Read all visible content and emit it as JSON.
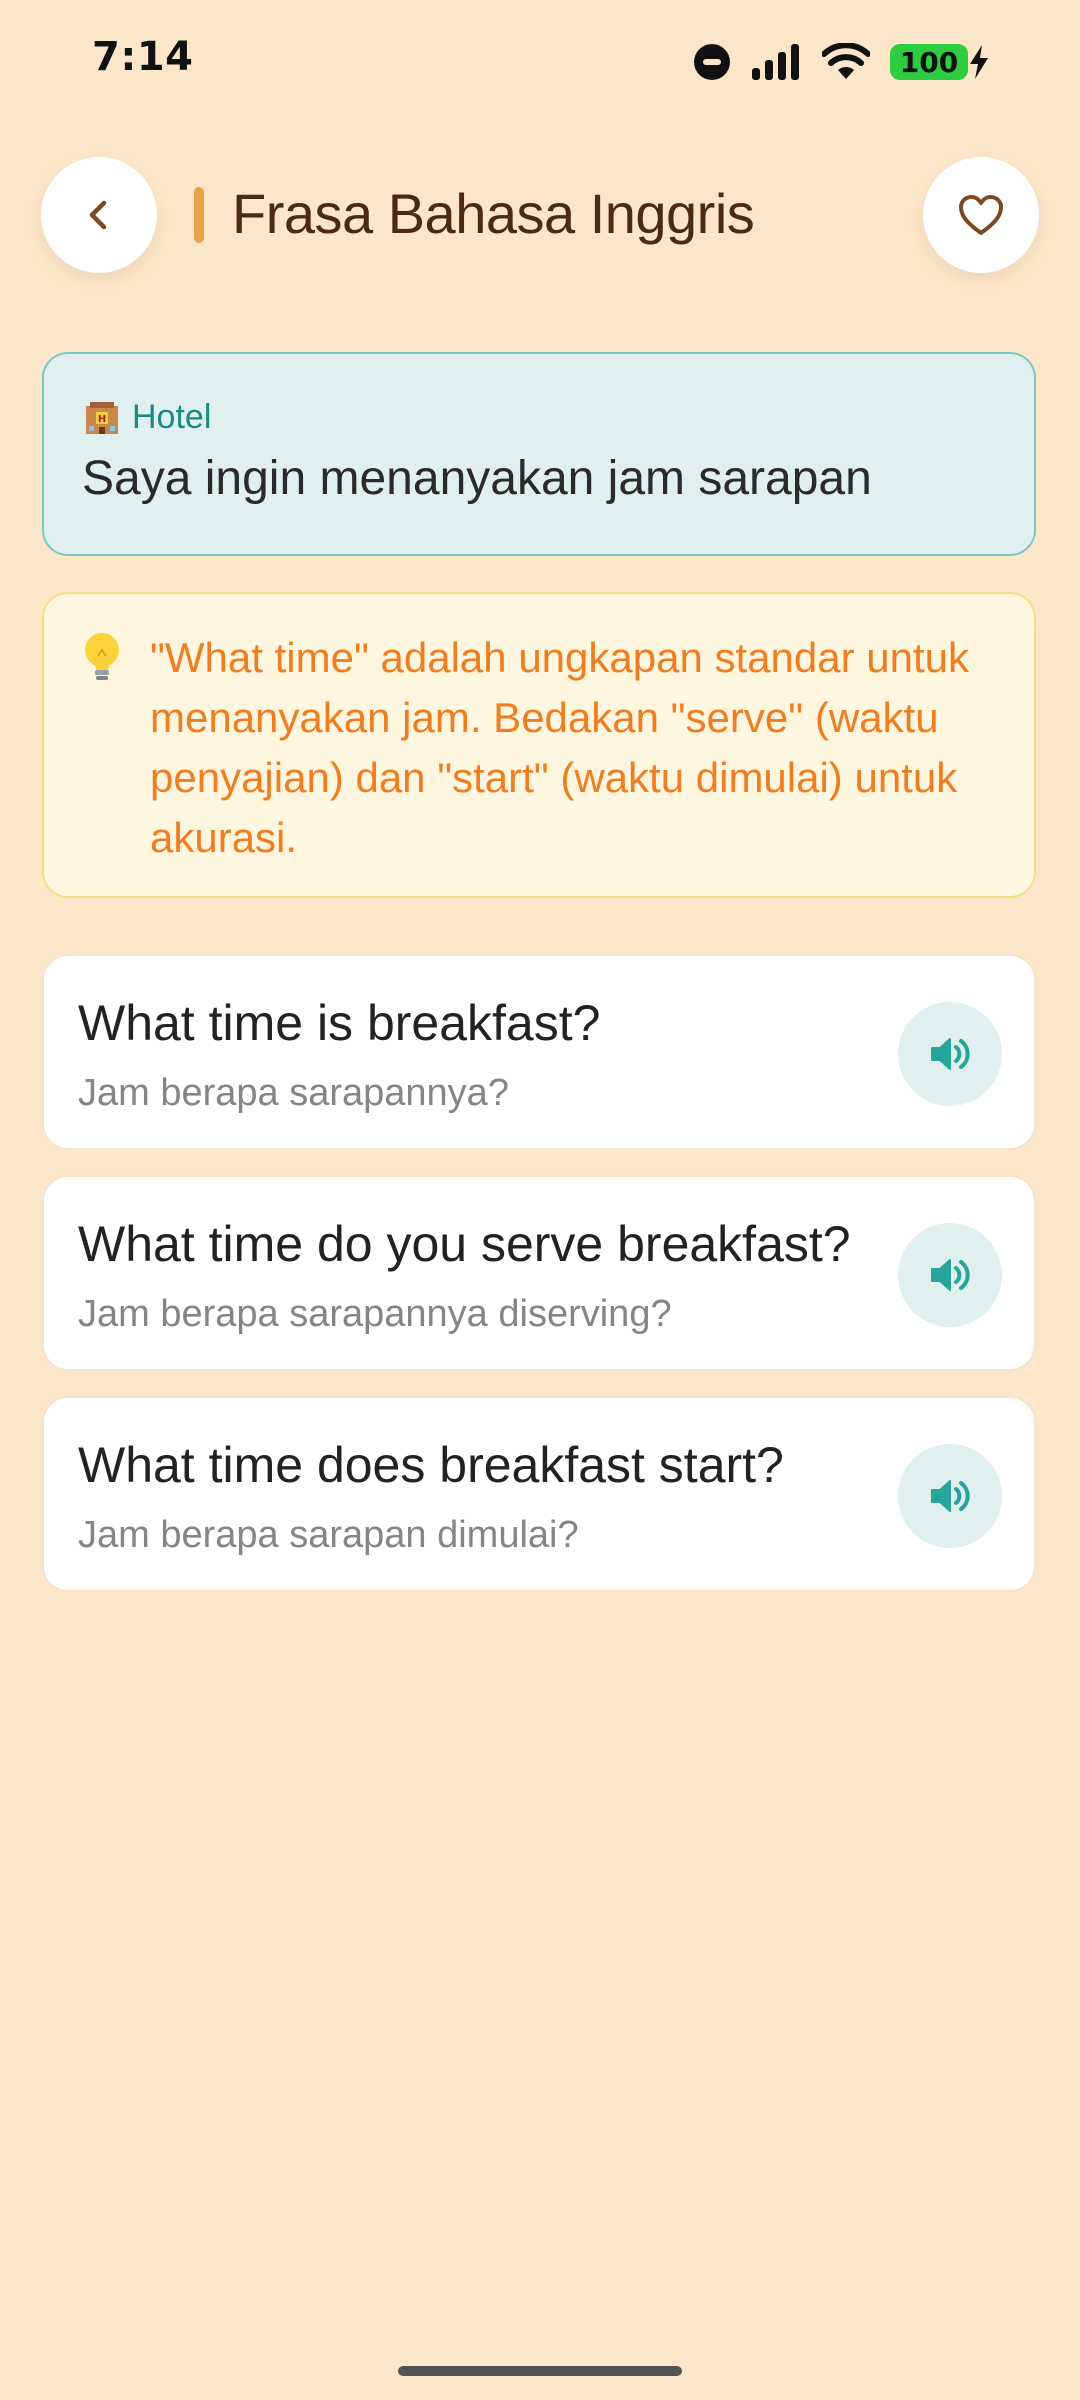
{
  "status_bar": {
    "time": "7:14",
    "battery_level": "100"
  },
  "header": {
    "title": "Frasa Bahasa Inggris"
  },
  "context": {
    "category_icon": "hotel-icon",
    "category": "Hotel",
    "text": "Saya ingin menanyakan jam sarapan"
  },
  "tip": {
    "icon": "lightbulb-icon",
    "text": "\"What time\" adalah ungkapan standar untuk menanyakan jam. Bedakan \"serve\" (waktu penyajian) dan \"start\" (waktu dimulai) untuk akurasi."
  },
  "phrases": [
    {
      "english": "What time is breakfast?",
      "indonesian": "Jam berapa sarapannya?"
    },
    {
      "english": "What time do you serve breakfast?",
      "indonesian": "Jam berapa sarapannya diserving?"
    },
    {
      "english": "What time does breakfast start?",
      "indonesian": "Jam berapa sarapan dimulai?"
    }
  ],
  "colors": {
    "background": "#fce6c9",
    "accent_teal": "#1b8a80",
    "tip_orange": "#ef7d22",
    "title_brown": "#4a2a12"
  }
}
